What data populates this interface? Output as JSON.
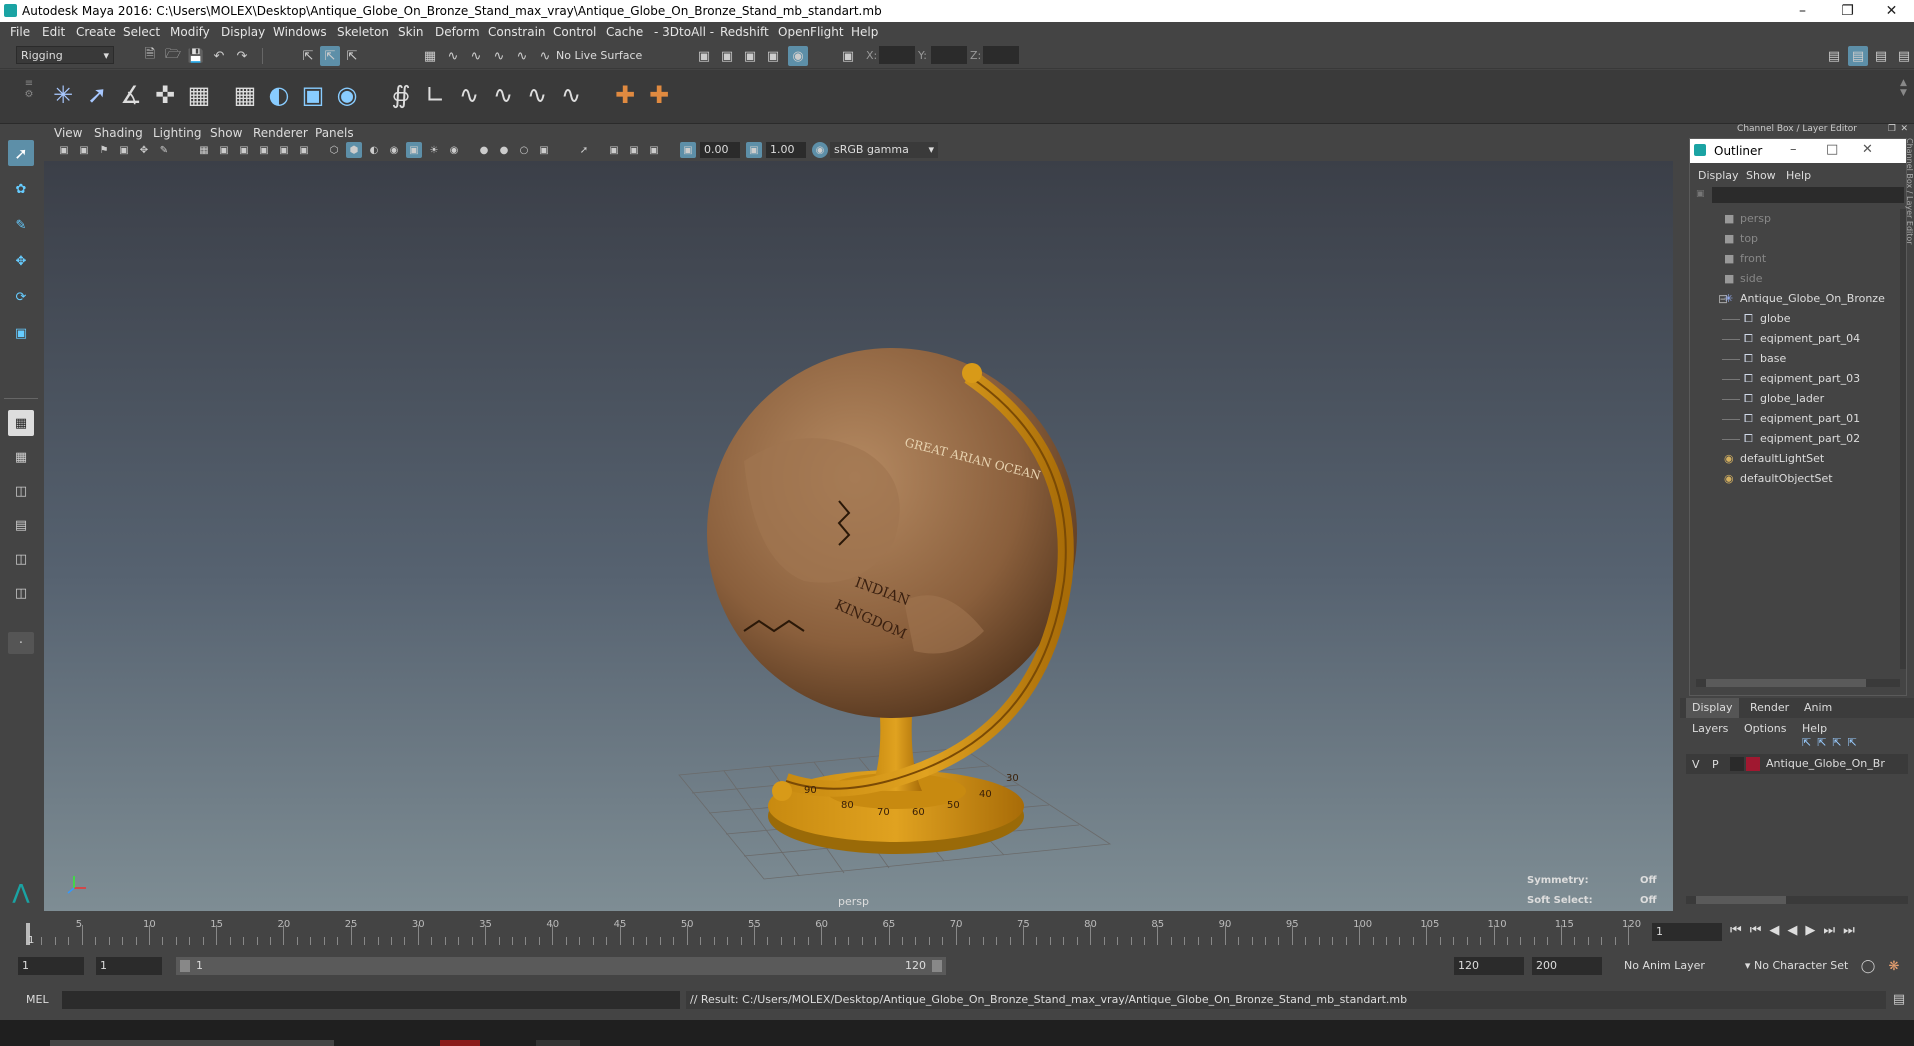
{
  "window": {
    "title": "Autodesk Maya 2016: C:\\Users\\MOLEX\\Desktop\\Antique_Globe_On_Bronze_Stand_max_vray\\Antique_Globe_On_Bronze_Stand_mb_standart.mb"
  },
  "menubar": [
    "File",
    "Edit",
    "Create",
    "Select",
    "Modify",
    "Display",
    "Windows",
    "Skeleton",
    "Skin",
    "Deform",
    "Constrain",
    "Control",
    "Cache",
    "- 3DtoAll -",
    "Redshift",
    "OpenFlight",
    "Help"
  ],
  "status": {
    "mode": "Rigging",
    "live_surface": "No Live Surface",
    "x_label": "X:",
    "y_label": "Y:",
    "z_label": "Z:"
  },
  "viewport": {
    "menus": [
      "View",
      "Shading",
      "Lighting",
      "Show",
      "Renderer",
      "Panels"
    ],
    "exposure": "0.00",
    "gamma": "1.00",
    "color_space": "sRGB gamma",
    "camera": "persp",
    "symmetry_label": "Symmetry:",
    "symmetry_value": "Off",
    "soft_select_label": "Soft Select:",
    "soft_select_value": "Off"
  },
  "rightpanel": {
    "title": "Channel Box / Layer Editor"
  },
  "outliner": {
    "title": "Outliner",
    "menus": [
      "Display",
      "Show",
      "Help"
    ],
    "items": [
      {
        "label": "persp",
        "kind": "camera",
        "depth": 0
      },
      {
        "label": "top",
        "kind": "camera",
        "depth": 0
      },
      {
        "label": "front",
        "kind": "camera",
        "depth": 0
      },
      {
        "label": "side",
        "kind": "camera",
        "depth": 0
      },
      {
        "label": "Antique_Globe_On_Bronze",
        "kind": "group",
        "depth": 0
      },
      {
        "label": "globe",
        "kind": "mesh",
        "depth": 1
      },
      {
        "label": "eqipment_part_04",
        "kind": "mesh",
        "depth": 1
      },
      {
        "label": "base",
        "kind": "mesh",
        "depth": 1
      },
      {
        "label": "eqipment_part_03",
        "kind": "mesh",
        "depth": 1
      },
      {
        "label": "globe_lader",
        "kind": "mesh",
        "depth": 1
      },
      {
        "label": "eqipment_part_01",
        "kind": "mesh",
        "depth": 1
      },
      {
        "label": "eqipment_part_02",
        "kind": "mesh",
        "depth": 1
      },
      {
        "label": "defaultLightSet",
        "kind": "set",
        "depth": 0
      },
      {
        "label": "defaultObjectSet",
        "kind": "set",
        "depth": 0
      }
    ]
  },
  "layers": {
    "tabs": [
      "Display",
      "Render",
      "Anim"
    ],
    "menus": [
      "Layers",
      "Options",
      "Help"
    ],
    "layer": {
      "v": "V",
      "p": "P",
      "name": "Antique_Globe_On_Br",
      "color": "#a01830"
    }
  },
  "timeline": {
    "ticks": [
      "5",
      "10",
      "15",
      "20",
      "25",
      "30",
      "35",
      "40",
      "45",
      "50",
      "55",
      "60",
      "65",
      "70",
      "75",
      "80",
      "85",
      "90",
      "95",
      "100",
      "105",
      "110",
      "115",
      "120"
    ],
    "current_frame": "1",
    "start_marker": "1"
  },
  "range": {
    "start": "1",
    "playback_start": "1",
    "slider_start": "1",
    "slider_end": "120",
    "playback_end": "120",
    "end": "200",
    "anim_layer": "No Anim Layer",
    "char_set": "No Character Set"
  },
  "cmd": {
    "lang": "MEL",
    "result": "// Result: C:/Users/MOLEX/Desktop/Antique_Globe_On_Bronze_Stand_max_vray/Antique_Globe_On_Bronze_Stand_mb_standart.mb"
  },
  "globe_labels": {
    "ocean": "GREAT ARIAN OCEAN",
    "kingdom_1": "INDIAN",
    "kingdom_2": "KINGDOM",
    "ring_numbers": [
      "90",
      "80",
      "70",
      "60",
      "50",
      "40",
      "30"
    ]
  }
}
